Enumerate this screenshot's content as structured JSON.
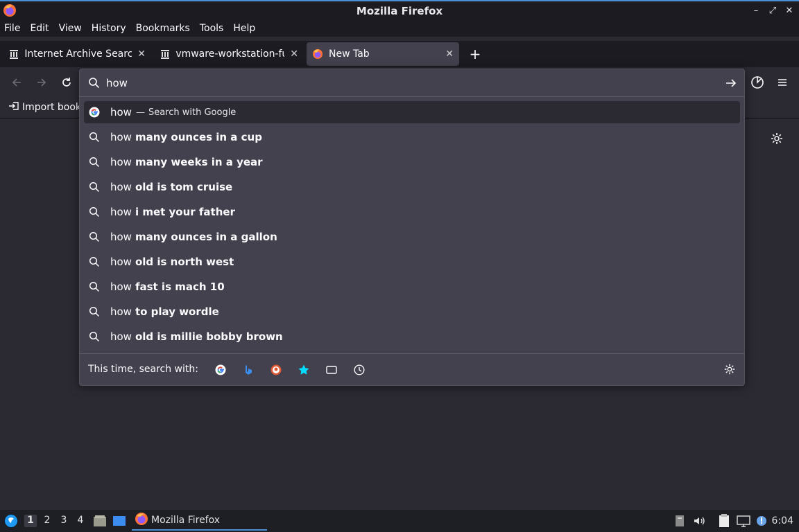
{
  "window": {
    "title": "Mozilla Firefox"
  },
  "menubar": {
    "items": [
      {
        "label": "File"
      },
      {
        "label": "Edit"
      },
      {
        "label": "View"
      },
      {
        "label": "History"
      },
      {
        "label": "Bookmarks"
      },
      {
        "label": "Tools"
      },
      {
        "label": "Help"
      }
    ]
  },
  "tabs": [
    {
      "title": "Internet Archive Search:",
      "icon": "archive-icon",
      "active": false
    },
    {
      "title": "vmware-workstation-full-",
      "icon": "archive-icon",
      "active": false
    },
    {
      "title": "New Tab",
      "icon": "firefox-icon",
      "active": true
    }
  ],
  "bookmarks": {
    "import_label": "Import book"
  },
  "urlbar": {
    "value": "how",
    "results": [
      {
        "typed": "how",
        "rest": "",
        "action": "Search with Google",
        "icon": "google-icon",
        "selected": true
      },
      {
        "typed": "how",
        "rest": "many ounces in a cup",
        "icon": "search-icon"
      },
      {
        "typed": "how",
        "rest": "many weeks in a year",
        "icon": "search-icon"
      },
      {
        "typed": "how",
        "rest": "old is tom cruise",
        "icon": "search-icon"
      },
      {
        "typed": "how",
        "rest": "i met your father",
        "icon": "search-icon"
      },
      {
        "typed": "how",
        "rest": "many ounces in a gallon",
        "icon": "search-icon"
      },
      {
        "typed": "how",
        "rest": "old is north west",
        "icon": "search-icon"
      },
      {
        "typed": "how",
        "rest": "fast is mach 10",
        "icon": "search-icon"
      },
      {
        "typed": "how",
        "rest": "to play wordle",
        "icon": "search-icon"
      },
      {
        "typed": "how",
        "rest": "old is millie bobby brown",
        "icon": "search-icon"
      }
    ],
    "oneoff_label": "This time, search with:",
    "engines": [
      "google-icon",
      "bing-icon",
      "duckduckgo-icon",
      "bookmarks-star-icon",
      "tabs-icon",
      "history-clock-icon"
    ]
  },
  "taskbar": {
    "workspaces": [
      "1",
      "2",
      "3",
      "4"
    ],
    "active_workspace": "1",
    "task_label": "Mozilla Firefox",
    "clock": "6:04"
  }
}
